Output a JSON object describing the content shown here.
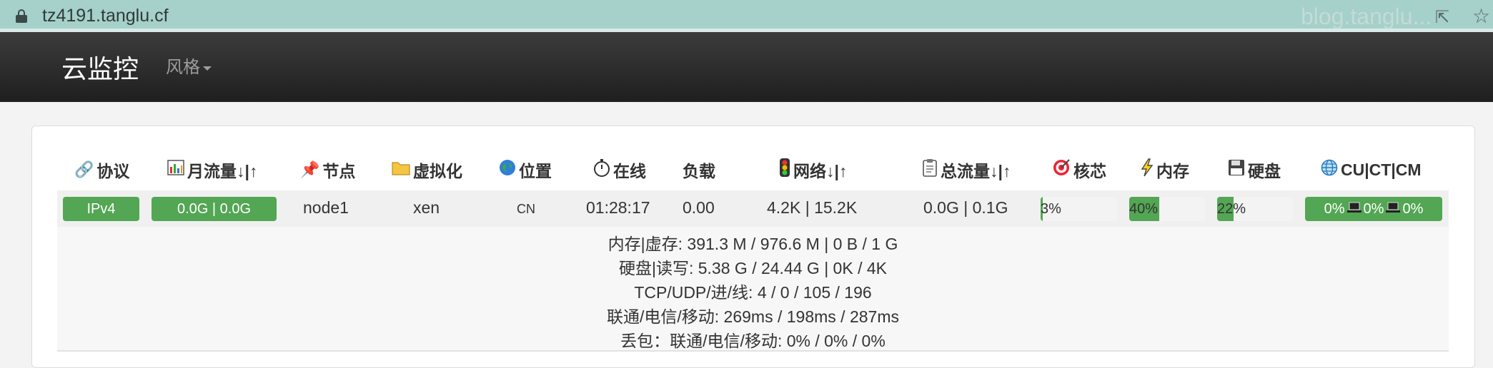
{
  "browser": {
    "url": "tz4191.tanglu.cf",
    "watermark": "blog.tanglu..."
  },
  "navbar": {
    "brand": "云监控",
    "style_menu": "风格"
  },
  "table": {
    "headers": {
      "protocol": "协议",
      "monthly_traffic": "月流量↓|↑",
      "node": "节点",
      "virt": "虚拟化",
      "location": "位置",
      "uptime": "在线",
      "load": "负载",
      "network": "网络↓|↑",
      "total_traffic": "总流量↓|↑",
      "cpu": "核芯",
      "memory": "内存",
      "disk": "硬盘",
      "ping": "CU|CT|CM"
    },
    "row": {
      "protocol": "IPv4",
      "monthly_traffic": "0.0G | 0.0G",
      "node": "node1",
      "virt": "xen",
      "location": "CN",
      "uptime": "01:28:17",
      "load": "0.00",
      "network": "4.2K | 15.2K",
      "total_traffic": "0.0G | 0.1G",
      "cpu": {
        "label": "3%",
        "value": 3
      },
      "memory": {
        "label": "40%",
        "value": 40
      },
      "disk": {
        "label": "22%",
        "value": 22
      },
      "ping": [
        "0%",
        "0%",
        "0%"
      ]
    },
    "details": [
      "内存|虚存: 391.3 M / 976.6 M | 0 B / 1 G",
      "硬盘|读写: 5.38 G / 24.44 G | 0K / 4K",
      "TCP/UDP/进/线: 4 / 0 / 105 / 196",
      "联通/电信/移动: 269ms / 198ms / 287ms",
      "丢包：联通/电信/移动: 0% / 0% / 0%"
    ]
  },
  "colors": {
    "accent_green": "#53a653",
    "navbar_dark": "#222222",
    "addressbar": "#a6d0ca"
  }
}
